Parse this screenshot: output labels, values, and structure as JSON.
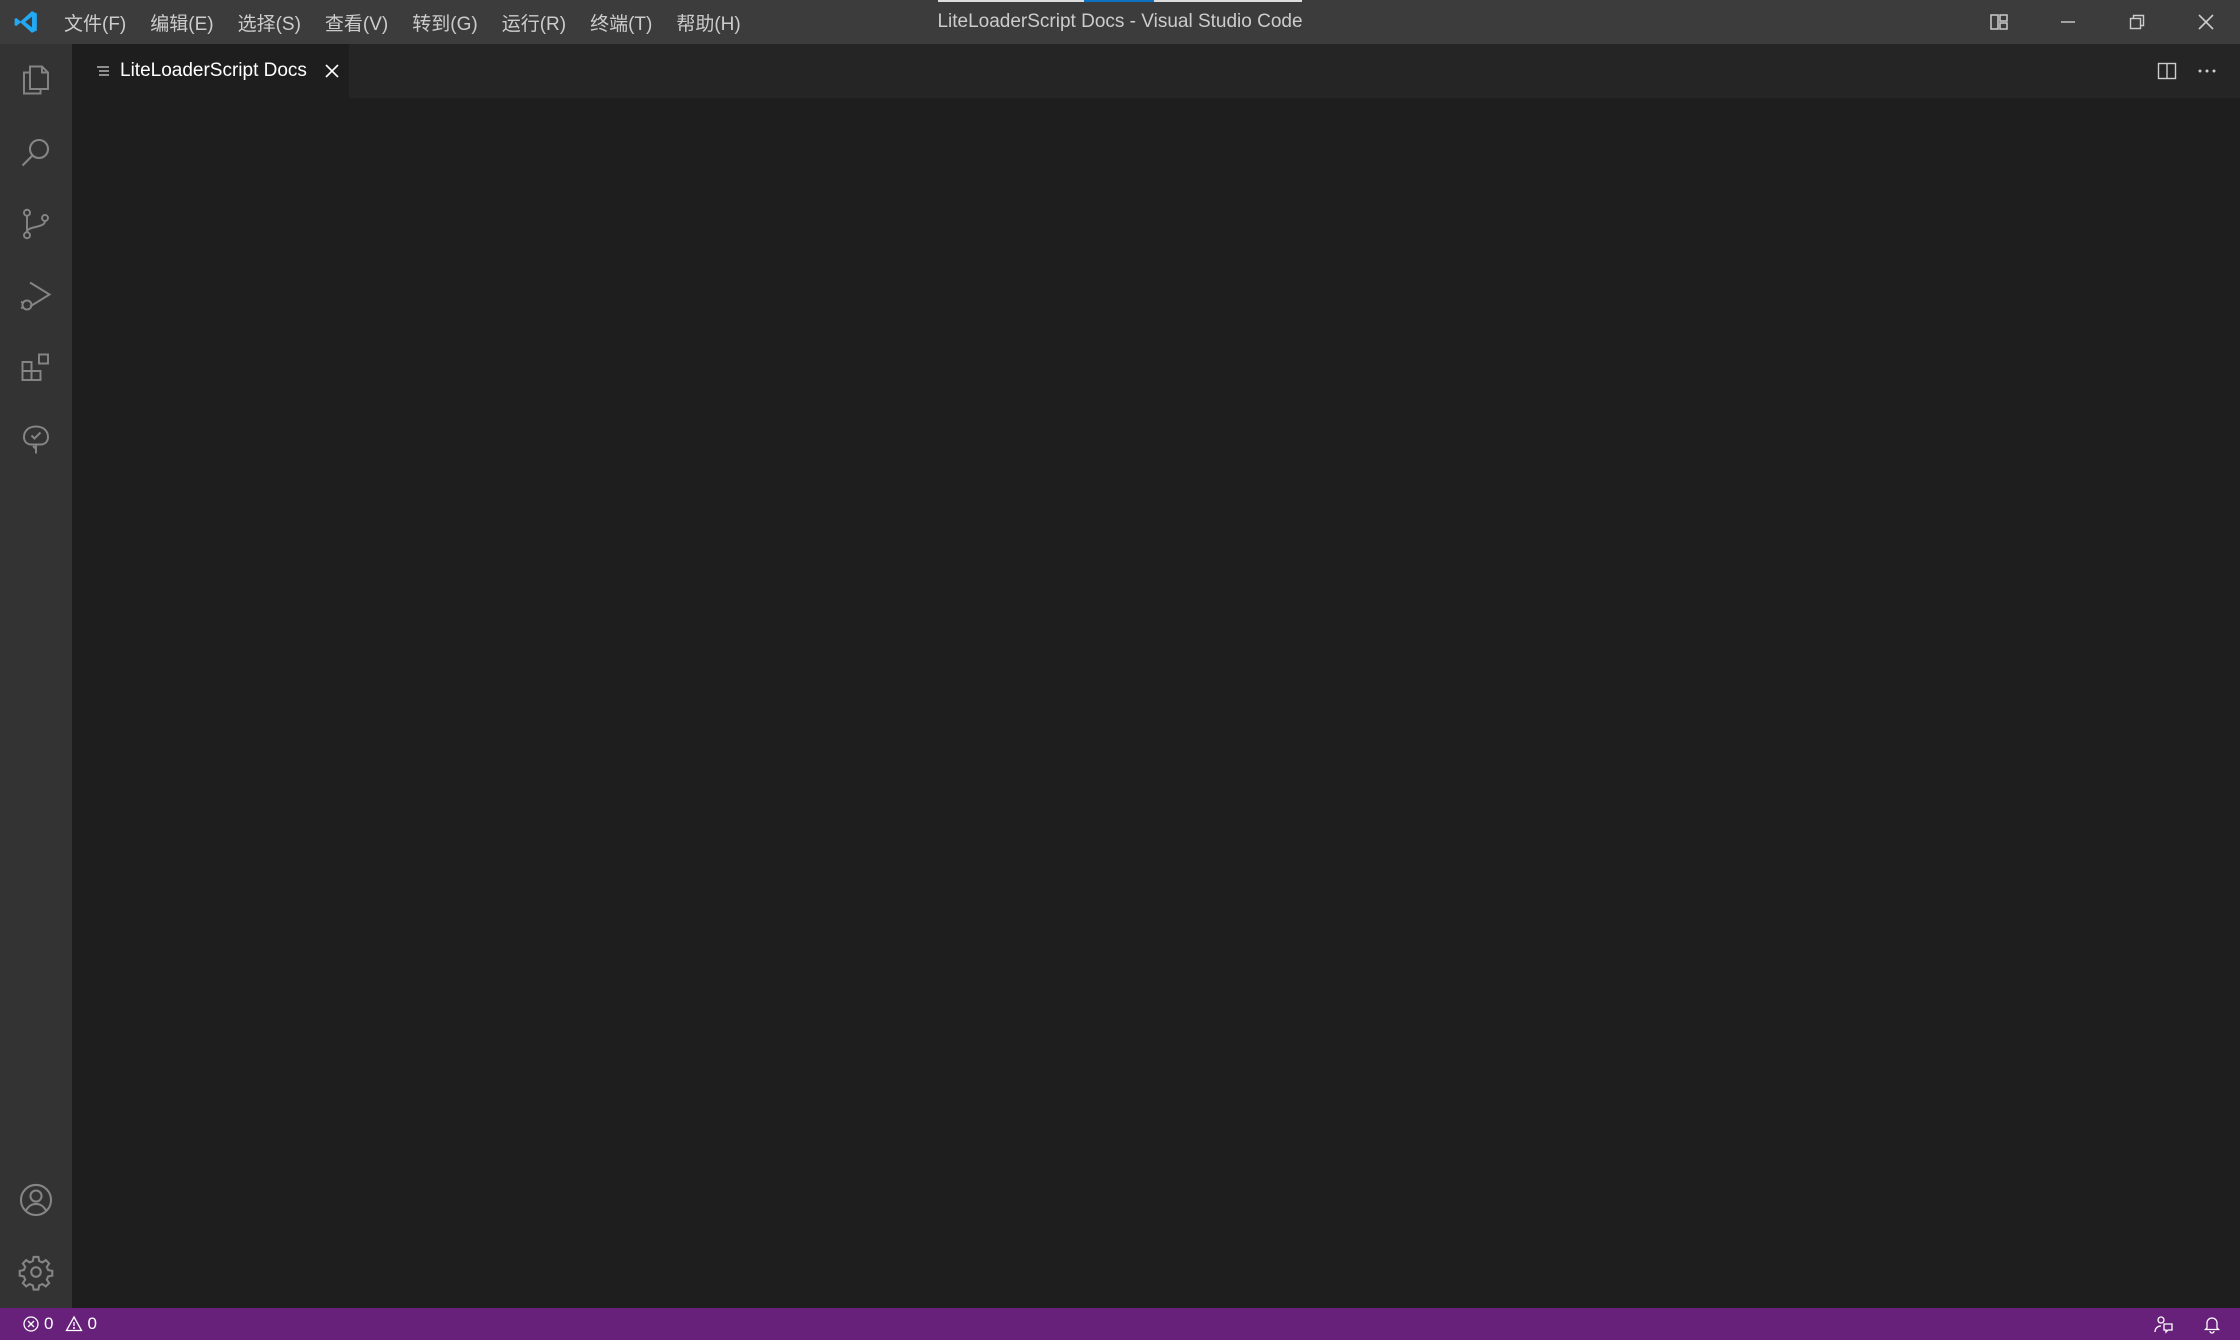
{
  "window": {
    "title": "LiteLoaderScript Docs - Visual Studio Code"
  },
  "menu": [
    {
      "label": "文件(F)"
    },
    {
      "label": "编辑(E)"
    },
    {
      "label": "选择(S)"
    },
    {
      "label": "查看(V)"
    },
    {
      "label": "转到(G)"
    },
    {
      "label": "运行(R)"
    },
    {
      "label": "终端(T)"
    },
    {
      "label": "帮助(H)"
    }
  ],
  "activity_bar": {
    "top": [
      "explorer-icon",
      "search-icon",
      "source-control-icon",
      "run-debug-icon",
      "extensions-icon",
      "test-tree-icon"
    ],
    "bottom": [
      "accounts-icon",
      "settings-gear-icon"
    ]
  },
  "tabs": [
    {
      "label": "LiteLoaderScript Docs",
      "icon": "preview-icon",
      "active": true
    }
  ],
  "status_bar": {
    "errors": "0",
    "warnings": "0",
    "background": "#68217a"
  },
  "colors": {
    "titlebar": "#3c3c3c",
    "activitybar": "#333333",
    "editor": "#1e1e1e",
    "statusbar": "#68217a",
    "accent": "#0e70c0"
  }
}
